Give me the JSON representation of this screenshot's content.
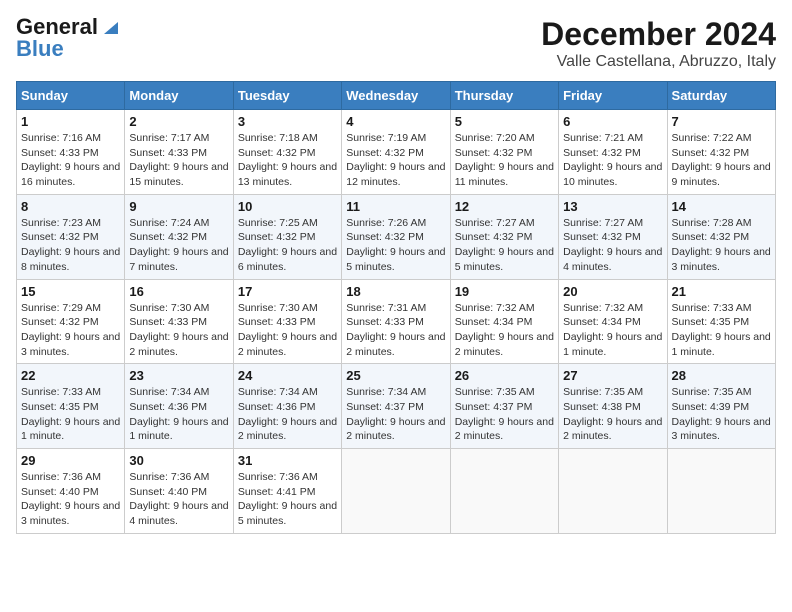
{
  "logo": {
    "line1": "General",
    "line2": "Blue"
  },
  "title": "December 2024",
  "subtitle": "Valle Castellana, Abruzzo, Italy",
  "days_of_week": [
    "Sunday",
    "Monday",
    "Tuesday",
    "Wednesday",
    "Thursday",
    "Friday",
    "Saturday"
  ],
  "weeks": [
    [
      {
        "num": "1",
        "sunrise": "7:16 AM",
        "sunset": "4:33 PM",
        "daylight": "9 hours and 16 minutes."
      },
      {
        "num": "2",
        "sunrise": "7:17 AM",
        "sunset": "4:33 PM",
        "daylight": "9 hours and 15 minutes."
      },
      {
        "num": "3",
        "sunrise": "7:18 AM",
        "sunset": "4:32 PM",
        "daylight": "9 hours and 13 minutes."
      },
      {
        "num": "4",
        "sunrise": "7:19 AM",
        "sunset": "4:32 PM",
        "daylight": "9 hours and 12 minutes."
      },
      {
        "num": "5",
        "sunrise": "7:20 AM",
        "sunset": "4:32 PM",
        "daylight": "9 hours and 11 minutes."
      },
      {
        "num": "6",
        "sunrise": "7:21 AM",
        "sunset": "4:32 PM",
        "daylight": "9 hours and 10 minutes."
      },
      {
        "num": "7",
        "sunrise": "7:22 AM",
        "sunset": "4:32 PM",
        "daylight": "9 hours and 9 minutes."
      }
    ],
    [
      {
        "num": "8",
        "sunrise": "7:23 AM",
        "sunset": "4:32 PM",
        "daylight": "9 hours and 8 minutes."
      },
      {
        "num": "9",
        "sunrise": "7:24 AM",
        "sunset": "4:32 PM",
        "daylight": "9 hours and 7 minutes."
      },
      {
        "num": "10",
        "sunrise": "7:25 AM",
        "sunset": "4:32 PM",
        "daylight": "9 hours and 6 minutes."
      },
      {
        "num": "11",
        "sunrise": "7:26 AM",
        "sunset": "4:32 PM",
        "daylight": "9 hours and 5 minutes."
      },
      {
        "num": "12",
        "sunrise": "7:27 AM",
        "sunset": "4:32 PM",
        "daylight": "9 hours and 5 minutes."
      },
      {
        "num": "13",
        "sunrise": "7:27 AM",
        "sunset": "4:32 PM",
        "daylight": "9 hours and 4 minutes."
      },
      {
        "num": "14",
        "sunrise": "7:28 AM",
        "sunset": "4:32 PM",
        "daylight": "9 hours and 3 minutes."
      }
    ],
    [
      {
        "num": "15",
        "sunrise": "7:29 AM",
        "sunset": "4:32 PM",
        "daylight": "9 hours and 3 minutes."
      },
      {
        "num": "16",
        "sunrise": "7:30 AM",
        "sunset": "4:33 PM",
        "daylight": "9 hours and 2 minutes."
      },
      {
        "num": "17",
        "sunrise": "7:30 AM",
        "sunset": "4:33 PM",
        "daylight": "9 hours and 2 minutes."
      },
      {
        "num": "18",
        "sunrise": "7:31 AM",
        "sunset": "4:33 PM",
        "daylight": "9 hours and 2 minutes."
      },
      {
        "num": "19",
        "sunrise": "7:32 AM",
        "sunset": "4:34 PM",
        "daylight": "9 hours and 2 minutes."
      },
      {
        "num": "20",
        "sunrise": "7:32 AM",
        "sunset": "4:34 PM",
        "daylight": "9 hours and 1 minute."
      },
      {
        "num": "21",
        "sunrise": "7:33 AM",
        "sunset": "4:35 PM",
        "daylight": "9 hours and 1 minute."
      }
    ],
    [
      {
        "num": "22",
        "sunrise": "7:33 AM",
        "sunset": "4:35 PM",
        "daylight": "9 hours and 1 minute."
      },
      {
        "num": "23",
        "sunrise": "7:34 AM",
        "sunset": "4:36 PM",
        "daylight": "9 hours and 1 minute."
      },
      {
        "num": "24",
        "sunrise": "7:34 AM",
        "sunset": "4:36 PM",
        "daylight": "9 hours and 2 minutes."
      },
      {
        "num": "25",
        "sunrise": "7:34 AM",
        "sunset": "4:37 PM",
        "daylight": "9 hours and 2 minutes."
      },
      {
        "num": "26",
        "sunrise": "7:35 AM",
        "sunset": "4:37 PM",
        "daylight": "9 hours and 2 minutes."
      },
      {
        "num": "27",
        "sunrise": "7:35 AM",
        "sunset": "4:38 PM",
        "daylight": "9 hours and 2 minutes."
      },
      {
        "num": "28",
        "sunrise": "7:35 AM",
        "sunset": "4:39 PM",
        "daylight": "9 hours and 3 minutes."
      }
    ],
    [
      {
        "num": "29",
        "sunrise": "7:36 AM",
        "sunset": "4:40 PM",
        "daylight": "9 hours and 3 minutes."
      },
      {
        "num": "30",
        "sunrise": "7:36 AM",
        "sunset": "4:40 PM",
        "daylight": "9 hours and 4 minutes."
      },
      {
        "num": "31",
        "sunrise": "7:36 AM",
        "sunset": "4:41 PM",
        "daylight": "9 hours and 5 minutes."
      },
      null,
      null,
      null,
      null
    ]
  ]
}
